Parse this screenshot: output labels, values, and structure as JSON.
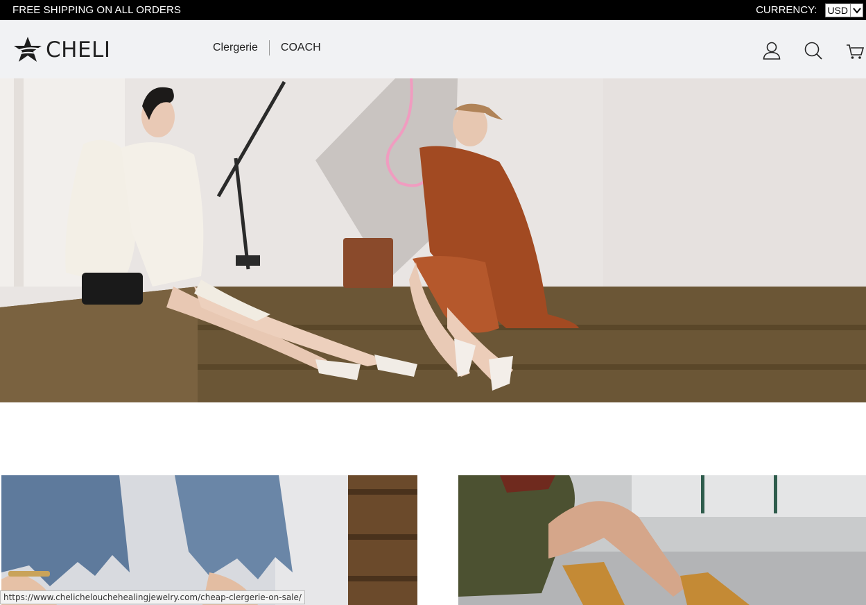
{
  "topbar": {
    "shipping_text": "FREE SHIPPING ON ALL ORDERS",
    "currency_label": "CURRENCY:",
    "currency_value": "USD"
  },
  "header": {
    "logo_text": "CHELI",
    "nav": [
      {
        "label": "Clergerie"
      },
      {
        "label": "COACH"
      }
    ],
    "icons": [
      "account-icon",
      "search-icon",
      "cart-icon"
    ]
  },
  "status_bar": {
    "url": "https://www.chelichelouchehealingjewelry.com/cheap-clergerie-on-sale/"
  }
}
